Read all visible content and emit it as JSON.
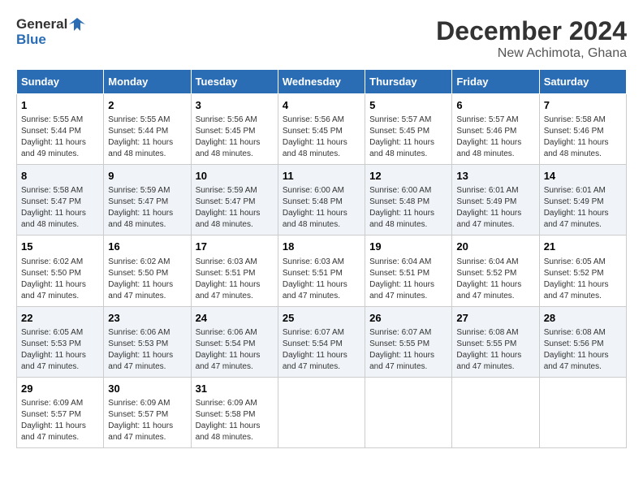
{
  "header": {
    "logo_line1": "General",
    "logo_line2": "Blue",
    "month": "December 2024",
    "location": "New Achimota, Ghana"
  },
  "columns": [
    "Sunday",
    "Monday",
    "Tuesday",
    "Wednesday",
    "Thursday",
    "Friday",
    "Saturday"
  ],
  "weeks": [
    [
      {
        "day": "1",
        "info": "Sunrise: 5:55 AM\nSunset: 5:44 PM\nDaylight: 11 hours\nand 49 minutes."
      },
      {
        "day": "2",
        "info": "Sunrise: 5:55 AM\nSunset: 5:44 PM\nDaylight: 11 hours\nand 48 minutes."
      },
      {
        "day": "3",
        "info": "Sunrise: 5:56 AM\nSunset: 5:45 PM\nDaylight: 11 hours\nand 48 minutes."
      },
      {
        "day": "4",
        "info": "Sunrise: 5:56 AM\nSunset: 5:45 PM\nDaylight: 11 hours\nand 48 minutes."
      },
      {
        "day": "5",
        "info": "Sunrise: 5:57 AM\nSunset: 5:45 PM\nDaylight: 11 hours\nand 48 minutes."
      },
      {
        "day": "6",
        "info": "Sunrise: 5:57 AM\nSunset: 5:46 PM\nDaylight: 11 hours\nand 48 minutes."
      },
      {
        "day": "7",
        "info": "Sunrise: 5:58 AM\nSunset: 5:46 PM\nDaylight: 11 hours\nand 48 minutes."
      }
    ],
    [
      {
        "day": "8",
        "info": "Sunrise: 5:58 AM\nSunset: 5:47 PM\nDaylight: 11 hours\nand 48 minutes."
      },
      {
        "day": "9",
        "info": "Sunrise: 5:59 AM\nSunset: 5:47 PM\nDaylight: 11 hours\nand 48 minutes."
      },
      {
        "day": "10",
        "info": "Sunrise: 5:59 AM\nSunset: 5:47 PM\nDaylight: 11 hours\nand 48 minutes."
      },
      {
        "day": "11",
        "info": "Sunrise: 6:00 AM\nSunset: 5:48 PM\nDaylight: 11 hours\nand 48 minutes."
      },
      {
        "day": "12",
        "info": "Sunrise: 6:00 AM\nSunset: 5:48 PM\nDaylight: 11 hours\nand 48 minutes."
      },
      {
        "day": "13",
        "info": "Sunrise: 6:01 AM\nSunset: 5:49 PM\nDaylight: 11 hours\nand 47 minutes."
      },
      {
        "day": "14",
        "info": "Sunrise: 6:01 AM\nSunset: 5:49 PM\nDaylight: 11 hours\nand 47 minutes."
      }
    ],
    [
      {
        "day": "15",
        "info": "Sunrise: 6:02 AM\nSunset: 5:50 PM\nDaylight: 11 hours\nand 47 minutes."
      },
      {
        "day": "16",
        "info": "Sunrise: 6:02 AM\nSunset: 5:50 PM\nDaylight: 11 hours\nand 47 minutes."
      },
      {
        "day": "17",
        "info": "Sunrise: 6:03 AM\nSunset: 5:51 PM\nDaylight: 11 hours\nand 47 minutes."
      },
      {
        "day": "18",
        "info": "Sunrise: 6:03 AM\nSunset: 5:51 PM\nDaylight: 11 hours\nand 47 minutes."
      },
      {
        "day": "19",
        "info": "Sunrise: 6:04 AM\nSunset: 5:51 PM\nDaylight: 11 hours\nand 47 minutes."
      },
      {
        "day": "20",
        "info": "Sunrise: 6:04 AM\nSunset: 5:52 PM\nDaylight: 11 hours\nand 47 minutes."
      },
      {
        "day": "21",
        "info": "Sunrise: 6:05 AM\nSunset: 5:52 PM\nDaylight: 11 hours\nand 47 minutes."
      }
    ],
    [
      {
        "day": "22",
        "info": "Sunrise: 6:05 AM\nSunset: 5:53 PM\nDaylight: 11 hours\nand 47 minutes."
      },
      {
        "day": "23",
        "info": "Sunrise: 6:06 AM\nSunset: 5:53 PM\nDaylight: 11 hours\nand 47 minutes."
      },
      {
        "day": "24",
        "info": "Sunrise: 6:06 AM\nSunset: 5:54 PM\nDaylight: 11 hours\nand 47 minutes."
      },
      {
        "day": "25",
        "info": "Sunrise: 6:07 AM\nSunset: 5:54 PM\nDaylight: 11 hours\nand 47 minutes."
      },
      {
        "day": "26",
        "info": "Sunrise: 6:07 AM\nSunset: 5:55 PM\nDaylight: 11 hours\nand 47 minutes."
      },
      {
        "day": "27",
        "info": "Sunrise: 6:08 AM\nSunset: 5:55 PM\nDaylight: 11 hours\nand 47 minutes."
      },
      {
        "day": "28",
        "info": "Sunrise: 6:08 AM\nSunset: 5:56 PM\nDaylight: 11 hours\nand 47 minutes."
      }
    ],
    [
      {
        "day": "29",
        "info": "Sunrise: 6:09 AM\nSunset: 5:57 PM\nDaylight: 11 hours\nand 47 minutes."
      },
      {
        "day": "30",
        "info": "Sunrise: 6:09 AM\nSunset: 5:57 PM\nDaylight: 11 hours\nand 47 minutes."
      },
      {
        "day": "31",
        "info": "Sunrise: 6:09 AM\nSunset: 5:58 PM\nDaylight: 11 hours\nand 48 minutes."
      },
      {
        "day": "",
        "info": ""
      },
      {
        "day": "",
        "info": ""
      },
      {
        "day": "",
        "info": ""
      },
      {
        "day": "",
        "info": ""
      }
    ]
  ]
}
